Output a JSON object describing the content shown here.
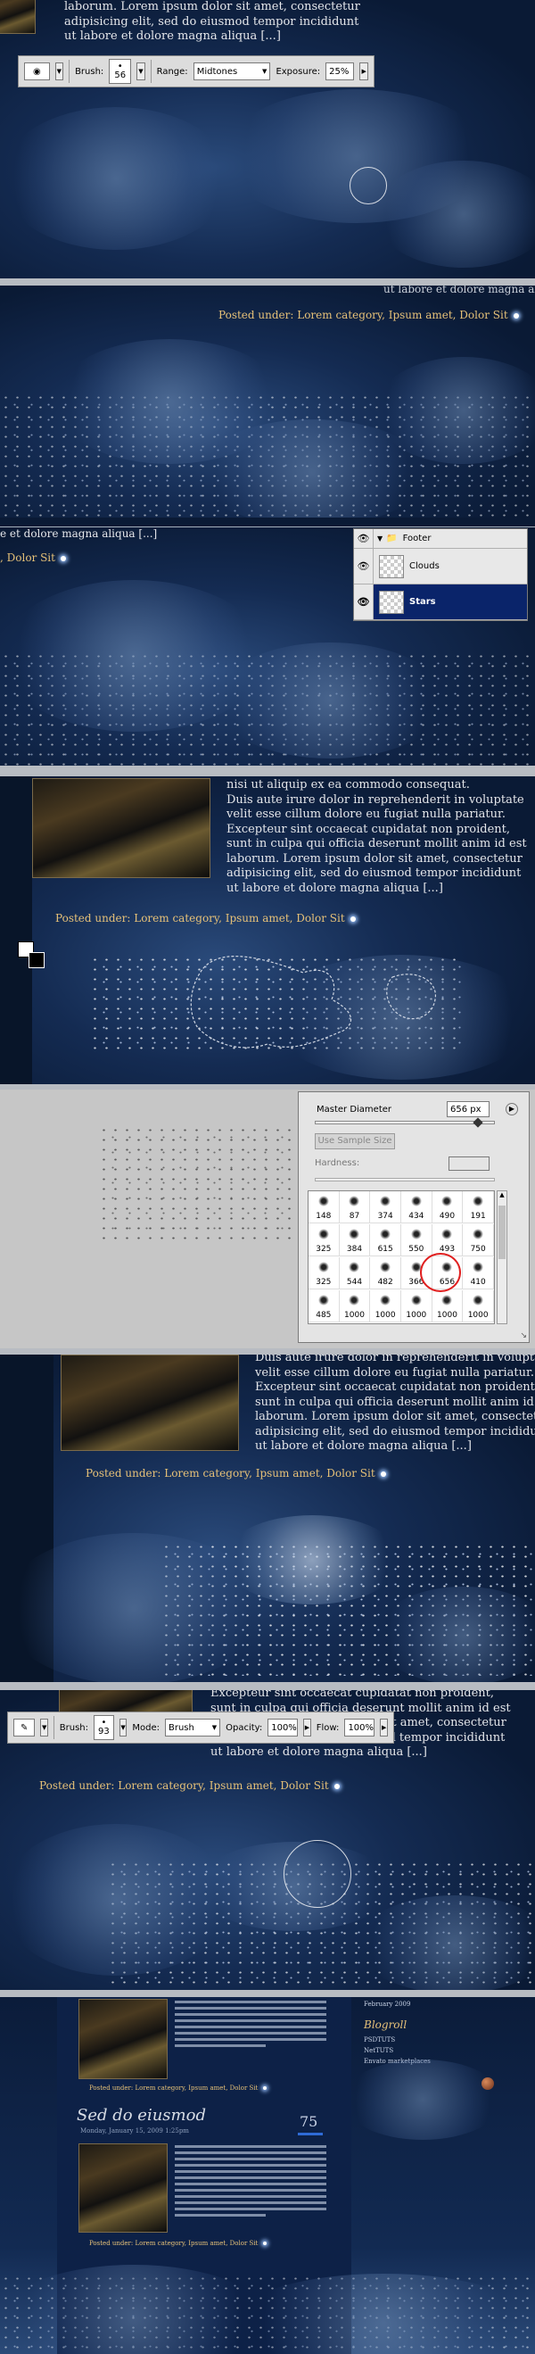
{
  "panel1": {
    "text_lines": [
      "laborum. Lorem ipsum dolor sit amet, consectetur",
      "adipisicing elit, sed do eiusmod tempor incididunt",
      "ut labore et dolore magna aliqua [...]"
    ],
    "toolbar": {
      "brush_label": "Brush:",
      "brush_size": "56",
      "range_label": "Range:",
      "range_value": "Midtones",
      "exposure_label": "Exposure:",
      "exposure_value": "25%"
    }
  },
  "panel2": {
    "corner_text": "ut labore et dolore magna aliqua",
    "posted_prefix": "Posted under: ",
    "posted_links": "Lorem category, Ipsum amet, Dolor Sit"
  },
  "panel3": {
    "line1": "e et dolore magna aliqua [...]",
    "line2": ", Dolor Sit",
    "layers": [
      {
        "name": "Footer",
        "type": "folder"
      },
      {
        "name": "Clouds",
        "type": "layer"
      },
      {
        "name": "Stars",
        "type": "layer",
        "selected": true
      }
    ]
  },
  "panel4": {
    "text_lines": [
      "nisi ut aliquip ex ea commodo consequat.",
      "Duis aute irure dolor in reprehenderit in voluptate",
      "velit esse cillum dolore eu fugiat nulla pariatur.",
      "Excepteur sint occaecat cupidatat non proident,",
      "sunt in culpa qui officia deserunt mollit anim id est",
      "laborum. Lorem ipsum dolor sit amet, consectetur",
      "adipisicing elit, sed do eiusmod tempor incididunt",
      "ut labore et dolore magna aliqua [...]"
    ],
    "posted_prefix": "Posted under: ",
    "posted_links": "Lorem category, Ipsum amet, Dolor Sit"
  },
  "panel5": {
    "master_diameter_label": "Master Diameter",
    "master_diameter_value": "656 px",
    "use_sample_size": "Use Sample Size",
    "hardness_label": "Hardness:",
    "brushes": [
      "148",
      "87",
      "374",
      "434",
      "490",
      "191",
      "325",
      "384",
      "615",
      "550",
      "493",
      "750",
      "325",
      "544",
      "482",
      "366",
      "656",
      "410",
      "485",
      "1000",
      "1000",
      "1000",
      "1000",
      "1000"
    ]
  },
  "panel6": {
    "text_lines": [
      "Duis aute irure dolor in reprehenderit in voluptate",
      "velit esse cillum dolore eu fugiat nulla pariatur.",
      "Excepteur sint occaecat cupidatat non proident,",
      "sunt in culpa qui officia deserunt mollit anim id est",
      "laborum. Lorem ipsum dolor sit amet, consectetur",
      "adipisicing elit, sed do eiusmod tempor incididunt",
      "ut labore et dolore magna aliqua [...]"
    ],
    "posted_prefix": "Posted under: ",
    "posted_links": "Lorem category, Ipsum amet, Dolor Sit"
  },
  "panel7": {
    "text_lines": [
      "Excepteur sint occaecat cupidatat non proident,",
      "sunt in culpa qui officia deserunt mollit anim id est",
      "laborum. Lorem ipsum dolor sit amet, consectetur",
      "adipisicing elit, sed do eiusmod tempor incididunt",
      "ut labore et dolore magna aliqua [...]"
    ],
    "toolbar": {
      "brush_label": "Brush:",
      "brush_size": "93",
      "mode_label": "Mode:",
      "mode_value": "Brush",
      "opacity_label": "Opacity:",
      "opacity_value": "100%",
      "flow_label": "Flow:",
      "flow_value": "100%"
    },
    "posted_prefix": "Posted under: ",
    "posted_links": "Lorem category, Ipsum amet, Dolor Sit"
  },
  "panel8": {
    "sidebar_date": "February 2009",
    "blogroll_title": "Blogroll",
    "blogroll_items": [
      "PSDTUTS",
      "NetTUTS",
      "Envato marketplaces"
    ],
    "post_title": "Sed do eiusmod",
    "post_meta": "Monday, January 15, 2009 1:25pm",
    "comment_count": "75",
    "posted_prefix": "Posted under: ",
    "posted_links": "Lorem category, Ipsum amet, Dolor Sit"
  }
}
